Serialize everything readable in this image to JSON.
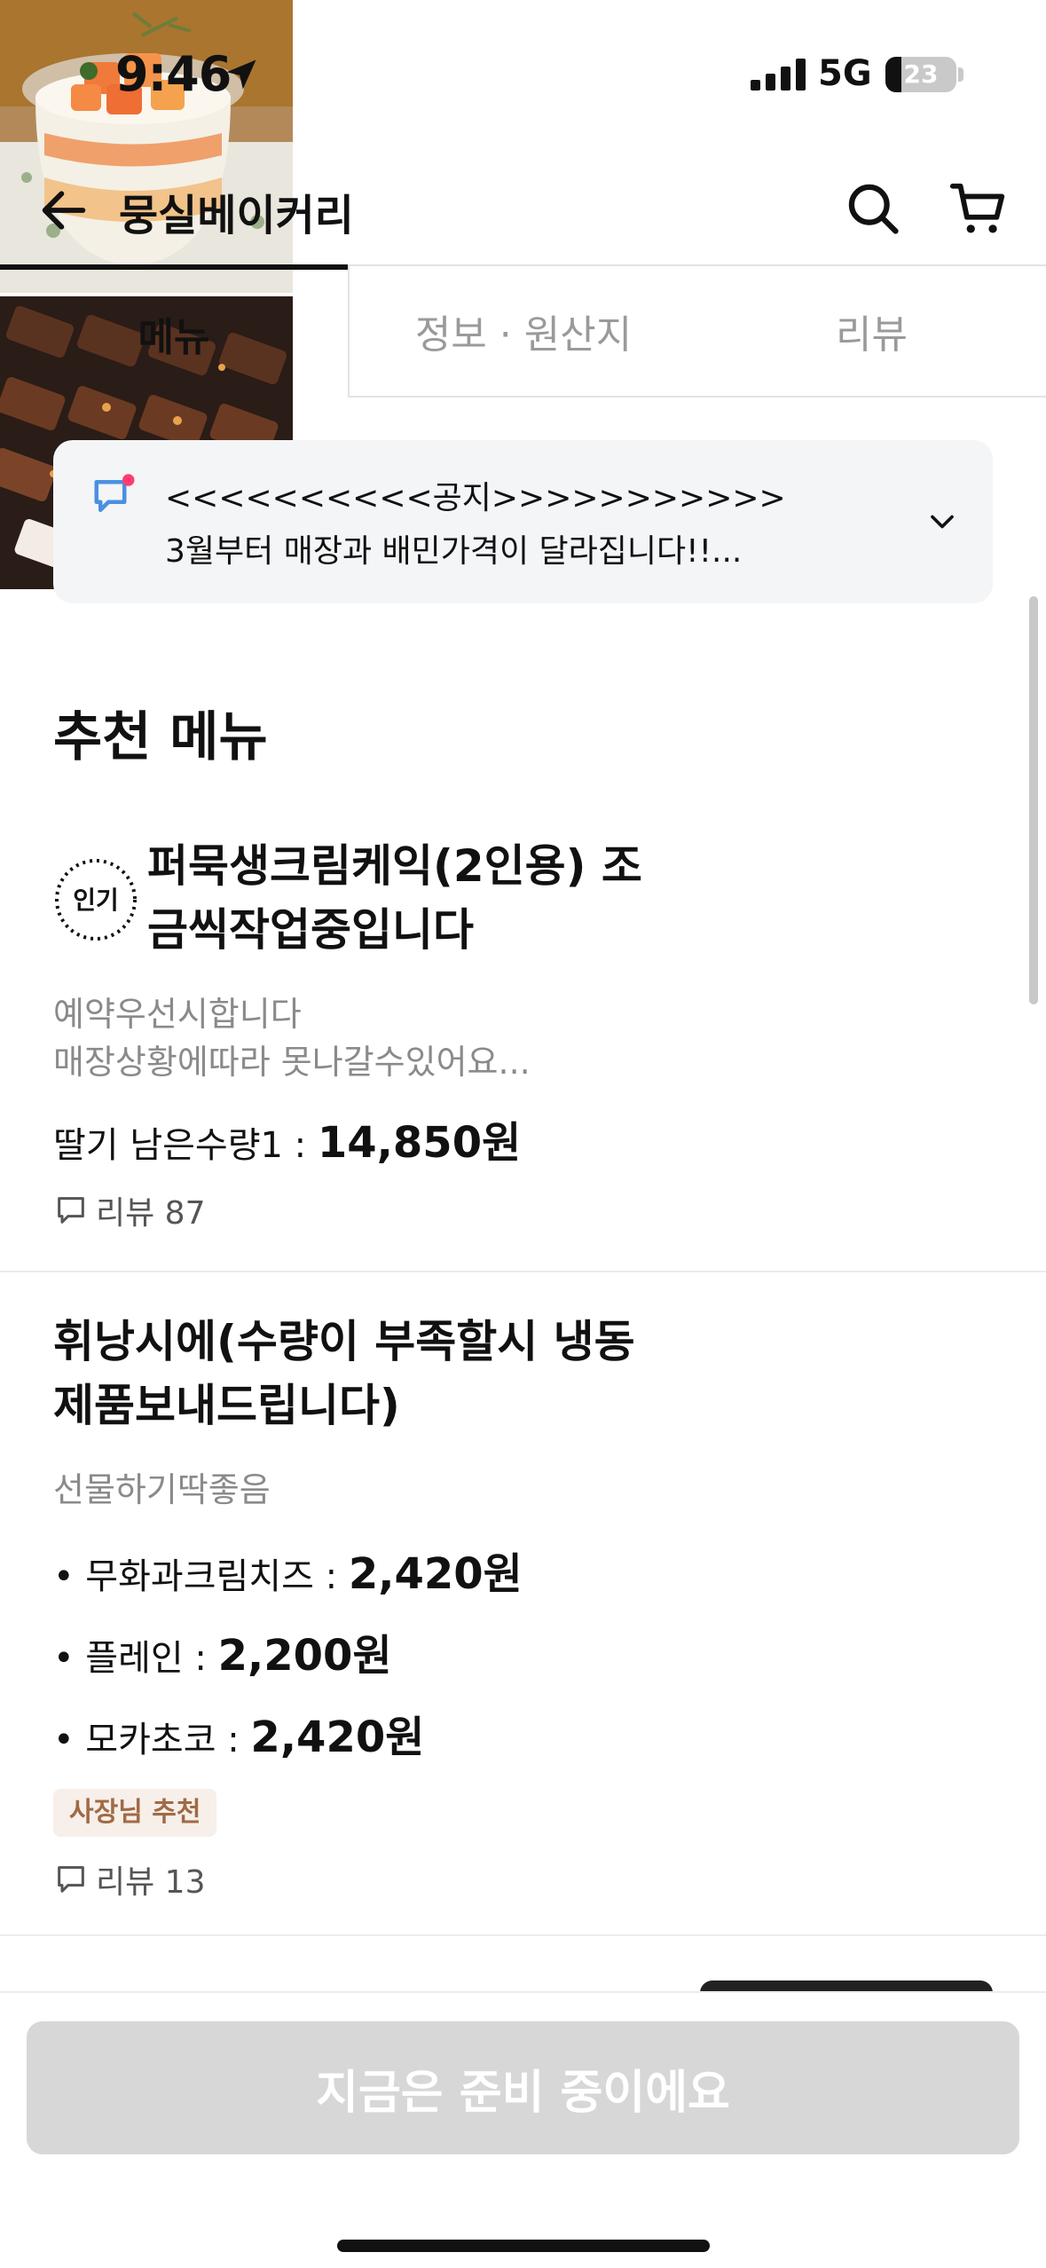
{
  "status_bar": {
    "time": "9:46",
    "network": "5G",
    "battery": "23",
    "battery_fraction": 0.23
  },
  "header": {
    "title": "뭉실베이커리",
    "back_icon": "arrow-left-icon",
    "search_icon": "search-icon",
    "cart_icon": "cart-icon"
  },
  "tabs": [
    {
      "label": "메뉴",
      "active": true
    },
    {
      "label": "정보 · 원산지",
      "active": false
    },
    {
      "label": "리뷰",
      "active": false
    }
  ],
  "notice": {
    "line1": "<<<<<<<<<<공지>>>>>>>>>>>",
    "line2": "3월부터 매장과 배민가격이 달라집니다!!...",
    "icon": "megaphone-icon",
    "accent": "#4a90e2",
    "dot": "#ff3d6e"
  },
  "section": {
    "title": "추천 메뉴"
  },
  "items": [
    {
      "badge": "인기",
      "name": "퍼묵생크림케익(2인용) 조금씩작업중입니다",
      "desc_lines": [
        "예약우선시합니다",
        "매장상황에따라 못나갈수있어요..."
      ],
      "price_label": "딸기 남은수량1 : ",
      "price": "14,850원",
      "review": "리뷰 87"
    },
    {
      "name": "휘낭시에(수량이 부족할시 냉동제품보내드립니다)",
      "desc": "선물하기딱좋음",
      "options": [
        {
          "label": "• 무화과크림치즈 : ",
          "price": "2,420원"
        },
        {
          "label": "• 플레인 : ",
          "price": "2,200원"
        },
        {
          "label": "• 모카초코 : ",
          "price": "2,420원"
        }
      ],
      "tag": "사장님 추천",
      "review": "리뷰 13"
    }
  ],
  "bottom": {
    "cta": "지금은 준비 중이에요"
  }
}
